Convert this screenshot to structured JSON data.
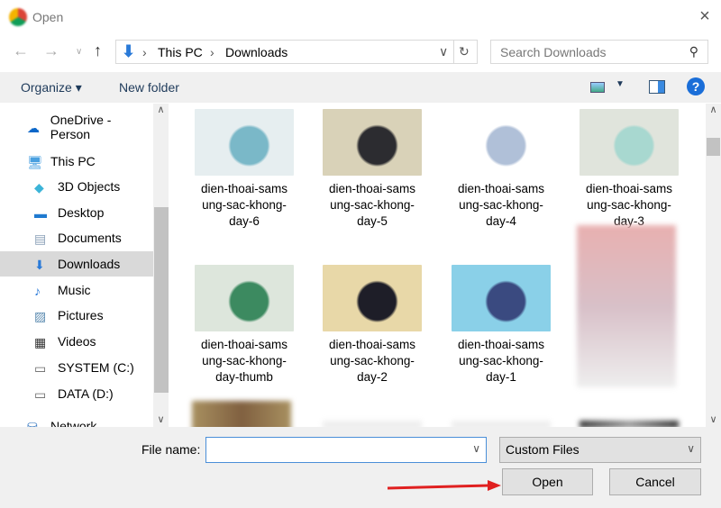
{
  "window": {
    "title": "Open",
    "close_icon": "×"
  },
  "address": {
    "crumbs": [
      "This PC",
      "Downloads"
    ],
    "search_placeholder": "Search Downloads"
  },
  "toolbar": {
    "organize": "Organize ▾",
    "new_folder": "New folder",
    "help": "?"
  },
  "sidebar": {
    "items": [
      {
        "label": "OneDrive - Person",
        "icon": "cloud-icon",
        "color": "#0a66c8"
      },
      {
        "label": "This PC",
        "icon": "computer-icon",
        "color": "#4aa0e0"
      },
      {
        "label": "3D Objects",
        "icon": "cube-icon",
        "color": "#3cb4d8"
      },
      {
        "label": "Desktop",
        "icon": "desktop-icon",
        "color": "#1f7ad0"
      },
      {
        "label": "Documents",
        "icon": "document-icon",
        "color": "#8aa0b8"
      },
      {
        "label": "Downloads",
        "icon": "download-icon",
        "color": "#2a7ad8"
      },
      {
        "label": "Music",
        "icon": "music-icon",
        "color": "#2a7ad8"
      },
      {
        "label": "Pictures",
        "icon": "pictures-icon",
        "color": "#5a8ab0"
      },
      {
        "label": "Videos",
        "icon": "videos-icon",
        "color": "#333"
      },
      {
        "label": "SYSTEM (C:)",
        "icon": "drive-icon",
        "color": "#666"
      },
      {
        "label": "DATA (D:)",
        "icon": "drive-icon",
        "color": "#666"
      },
      {
        "label": "Network",
        "icon": "network-icon",
        "color": "#3a7ac0"
      }
    ]
  },
  "files": [
    {
      "name": "dien-thoai-samsung-sac-khong-day-6",
      "lines": [
        "dien-thoai-sams",
        "ung-sac-khong-",
        "day-6"
      ],
      "colors": [
        "#e6eef0",
        "#7ab8c8"
      ]
    },
    {
      "name": "dien-thoai-samsung-sac-khong-day-5",
      "lines": [
        "dien-thoai-sams",
        "ung-sac-khong-",
        "day-5"
      ],
      "colors": [
        "#d9d2b8",
        "#2c2c30"
      ]
    },
    {
      "name": "dien-thoai-samsung-sac-khong-day-4",
      "lines": [
        "dien-thoai-sams",
        "ung-sac-khong-",
        "day-4"
      ],
      "colors": [
        "#ffffff",
        "#b0c0d8"
      ]
    },
    {
      "name": "dien-thoai-samsung-sac-khong-day-3",
      "lines": [
        "dien-thoai-sams",
        "ung-sac-khong-",
        "day-3"
      ],
      "colors": [
        "#e0e4dc",
        "#a8d8d0"
      ]
    },
    {
      "name": "dien-thoai-samsung-sac-khong-day-thumb",
      "lines": [
        "dien-thoai-sams",
        "ung-sac-khong-",
        "day-thumb"
      ],
      "colors": [
        "#dde6dc",
        "#3c8a60"
      ]
    },
    {
      "name": "dien-thoai-samsung-sac-khong-day-2",
      "lines": [
        "dien-thoai-sams",
        "ung-sac-khong-",
        "day-2"
      ],
      "colors": [
        "#e8d8a8",
        "#1e1e28"
      ]
    },
    {
      "name": "dien-thoai-samsung-sac-khong-day-1",
      "lines": [
        "dien-thoai-sams",
        "ung-sac-khong-",
        "day-1"
      ],
      "colors": [
        "#8ad0e8",
        "#3a4a80"
      ]
    }
  ],
  "bottom": {
    "file_name_label": "File name:",
    "file_name_value": "",
    "file_type": "Custom Files",
    "open": "Open",
    "cancel": "Cancel"
  }
}
